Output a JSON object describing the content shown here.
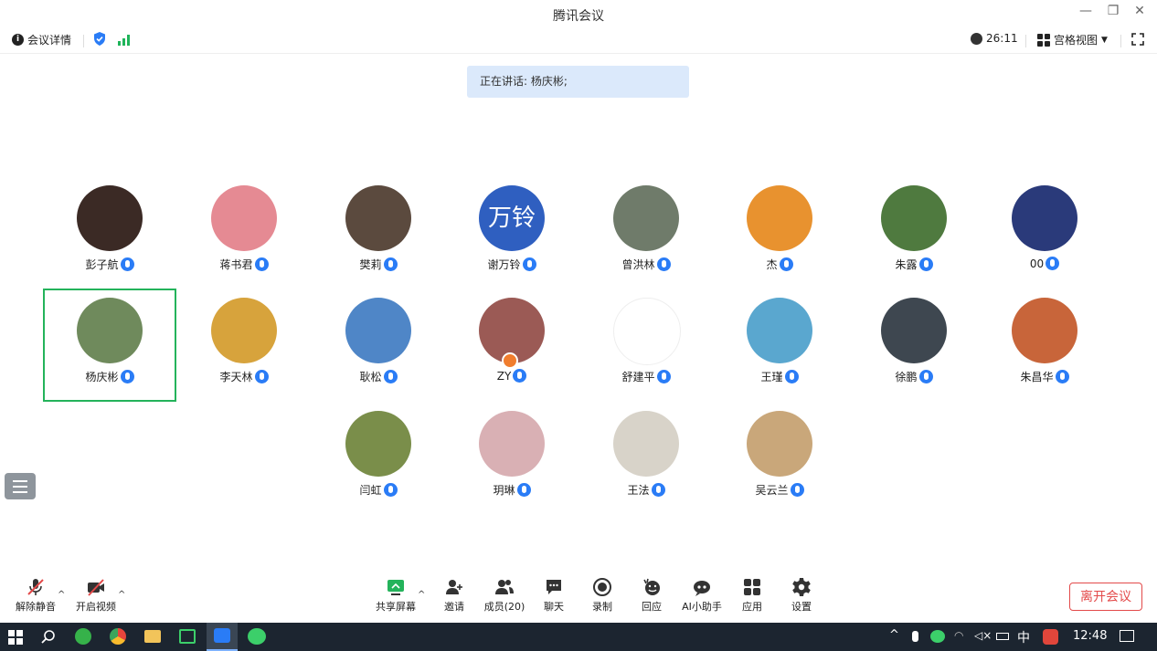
{
  "window": {
    "title": "腾讯会议"
  },
  "top_toolbar": {
    "meeting_details": "会议详情",
    "timer": "26:11",
    "view_mode": "宫格视图"
  },
  "speaking": {
    "text": "正在讲话: 杨庆彬;"
  },
  "participants": [
    {
      "name": "彭子航",
      "avatar_color": "#3b2a25"
    },
    {
      "name": "蒋书君",
      "avatar_color": "#e58a93"
    },
    {
      "name": "樊莉",
      "avatar_color": "#5b4a3e"
    },
    {
      "name": "谢万铃",
      "avatar_text": "万铃",
      "avatar_color": "#2f5fc0"
    },
    {
      "name": "曾洪林",
      "avatar_color": "#6f7b6a"
    },
    {
      "name": "杰",
      "avatar_color": "#e8922f"
    },
    {
      "name": "朱露",
      "avatar_color": "#4f7a3f"
    },
    {
      "name": "00",
      "avatar_color": "#2a3a7a"
    },
    {
      "name": "杨庆彬",
      "avatar_color": "#6f8a5c",
      "active": true
    },
    {
      "name": "李天林",
      "avatar_color": "#d7a33c"
    },
    {
      "name": "耿松",
      "avatar_color": "#4f86c7"
    },
    {
      "name": "ZY",
      "avatar_color": "#9b5a55",
      "host": true
    },
    {
      "name": "舒建平",
      "avatar_color": "#ffffff"
    },
    {
      "name": "王瑾",
      "avatar_color": "#5aa7cf"
    },
    {
      "name": "徐鹏",
      "avatar_color": "#3e4750"
    },
    {
      "name": "朱昌华",
      "avatar_color": "#c8653a"
    },
    {
      "name": "闫虹",
      "avatar_color": "#7a8e4a"
    },
    {
      "name": "玥琳",
      "avatar_color": "#d9b0b4"
    },
    {
      "name": "王法",
      "avatar_color": "#d8d3c9"
    },
    {
      "name": "吴云兰",
      "avatar_color": "#c9a77a"
    }
  ],
  "bottom_toolbar": {
    "unmute": "解除静音",
    "start_video": "开启视频",
    "share_screen": "共享屏幕",
    "invite": "邀请",
    "members": "成员(20)",
    "chat": "聊天",
    "record": "录制",
    "reply": "回应",
    "ai_assistant": "AI小助手",
    "apps": "应用",
    "settings": "设置",
    "leave": "离开会议"
  },
  "taskbar": {
    "ime": "中",
    "time": "12:48"
  },
  "colors": {
    "accent_green": "#24b35b",
    "mic_blue": "#2a7cf6",
    "leave_red": "#e34a4a"
  }
}
